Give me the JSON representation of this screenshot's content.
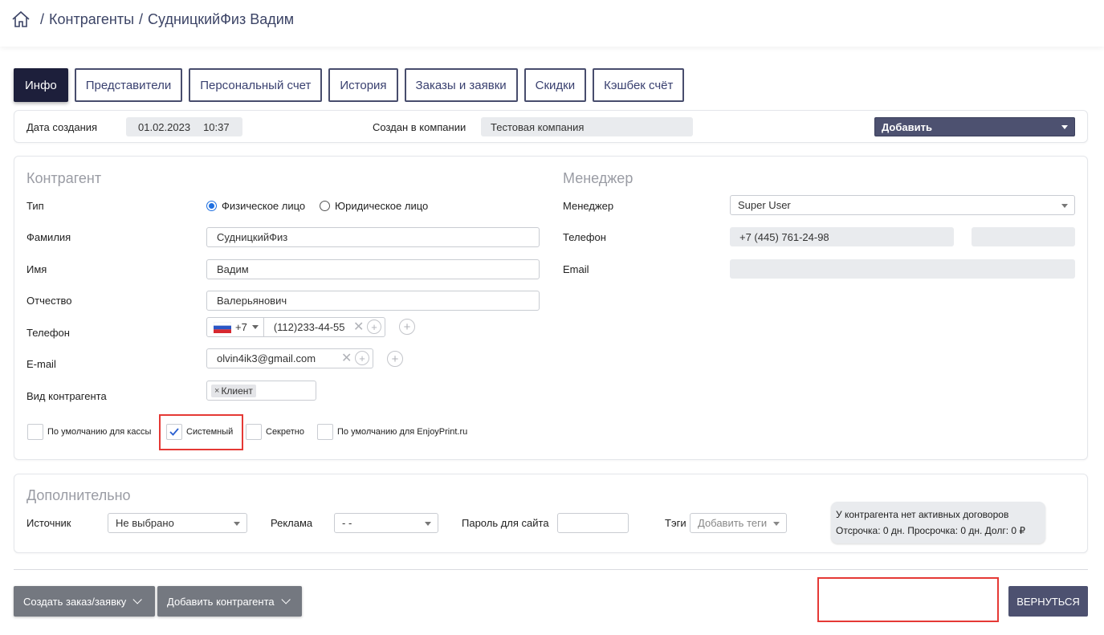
{
  "breadcrumb": {
    "sep": "/",
    "items": [
      "Контрагенты",
      "СудницкийФиз Вадим"
    ]
  },
  "tabs": [
    "Инфо",
    "Представители",
    "Персональный счет",
    "История",
    "Заказы и заявки",
    "Скидки",
    "Кэшбек счёт"
  ],
  "meta": {
    "created_label": "Дата создания",
    "created_date": "01.02.2023",
    "created_time": "10:37",
    "company_label": "Создан в компании",
    "company_value": "Тестовая компания",
    "add_select": "Добавить"
  },
  "counterparty": {
    "title": "Контрагент",
    "type_label": "Тип",
    "type_options": [
      "Физическое лицо",
      "Юридическое лицо"
    ],
    "type_selected": "Физическое лицо",
    "lastname_label": "Фамилия",
    "lastname_value": "СудницкийФиз",
    "firstname_label": "Имя",
    "firstname_value": "Вадим",
    "middlename_label": "Отчество",
    "middlename_value": "Валерьянович",
    "phone_label": "Телефон",
    "phone_code": "+7",
    "phone_value": "(112)233-44-55",
    "email_label": "E-mail",
    "email_value": "olvin4ik3@gmail.com",
    "kind_label": "Вид контрагента",
    "kind_tag": "Клиент",
    "checkboxes": [
      {
        "label": "По умолчанию для кассы",
        "checked": false
      },
      {
        "label": "Системный",
        "checked": true
      },
      {
        "label": "Секретно",
        "checked": false
      },
      {
        "label": "По умолчанию для EnjoyPrint.ru",
        "checked": false
      }
    ]
  },
  "manager": {
    "title": "Менеджер",
    "manager_label": "Менеджер",
    "manager_value": "Super User",
    "phone_label": "Телефон",
    "phone_value": "+7 (445) 761-24-98",
    "email_label": "Email"
  },
  "extra": {
    "title": "Дополнительно",
    "source_label": "Источник",
    "source_value": "Не выбрано",
    "ads_label": "Реклама",
    "ads_value": "- -",
    "password_label": "Пароль для сайта",
    "tags_label": "Тэги",
    "tags_placeholder": "Добавить теги",
    "contracts_line1": "У контрагента нет активных договоров",
    "contracts_line2": "Отсрочка: 0 дн. Просрочка: 0 дн. Долг: 0 ₽"
  },
  "footer": {
    "create_order": "Создать заказ/заявку",
    "add_counterparty": "Добавить контрагента",
    "back": "ВЕРНУТЬСЯ"
  },
  "colors": {
    "accent": "#1d1f3b",
    "dark_button": "#4d5170",
    "highlight": "#e53935",
    "radio_on": "#1e6fe0"
  }
}
